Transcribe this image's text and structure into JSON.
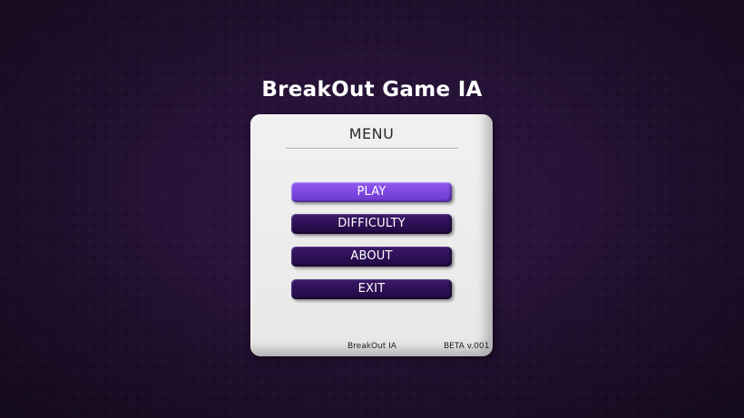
{
  "game": {
    "title": "BreakOut Game IA"
  },
  "menu": {
    "heading": "MENU",
    "buttons": [
      {
        "label": "PLAY",
        "active": true
      },
      {
        "label": "DIFFICULTY",
        "active": false
      },
      {
        "label": "ABOUT",
        "active": false
      },
      {
        "label": "EXIT",
        "active": false
      }
    ],
    "footer": {
      "name": "BreakOut IA",
      "version": "BETA v.001"
    }
  },
  "colors": {
    "background": "#241133",
    "panel": "#efefef",
    "button": "#2a0f52",
    "button_active": "#8451e6",
    "title_text": "#ffffff"
  }
}
